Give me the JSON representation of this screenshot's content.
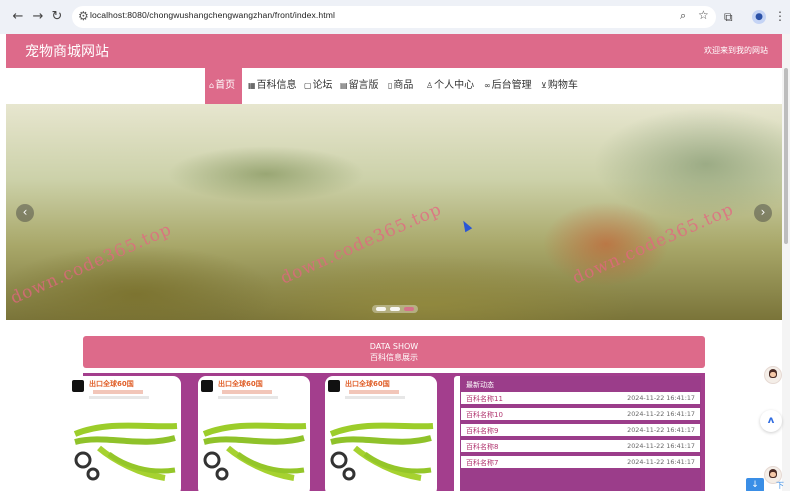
{
  "browser": {
    "url": "localhost:8080/chongwushangchengwangzhan/front/index.html",
    "back_icon": "arrow-left-icon",
    "forward_icon": "arrow-right-icon",
    "reload_icon": "reload-icon"
  },
  "header": {
    "site_title": "宠物商城网站",
    "welcome": "欢迎来到我的网站"
  },
  "nav": [
    {
      "label": "首页",
      "icon": "home-icon",
      "active": true
    },
    {
      "label": "百科信息",
      "icon": "grid-icon",
      "active": false
    },
    {
      "label": "论坛",
      "icon": "forum-icon",
      "active": false
    },
    {
      "label": "留言版",
      "icon": "message-icon",
      "active": false
    },
    {
      "label": "商品",
      "icon": "goods-icon",
      "active": false
    },
    {
      "label": "个人中心",
      "icon": "user-icon",
      "active": false
    },
    {
      "label": "后台管理",
      "icon": "link-icon",
      "active": false
    },
    {
      "label": "购物车",
      "icon": "cart-icon",
      "active": false
    }
  ],
  "banner": {
    "watermark": "down.code365.top",
    "active_slide": 1,
    "slide_count": 3
  },
  "section": {
    "title_en": "DATA SHOW",
    "title_cn": "百科信息展示"
  },
  "products": [
    {
      "tag": "出口全球60国"
    },
    {
      "tag": "出口全球60国"
    },
    {
      "tag": "出口全球60国"
    }
  ],
  "news": {
    "title": "最新动态",
    "items": [
      {
        "name": "百科名称11",
        "time": "2024-11-22 16:41:17"
      },
      {
        "name": "百科名称10",
        "time": "2024-11-22 16:41:17"
      },
      {
        "name": "百科名称9",
        "time": "2024-11-22 16:41:17"
      },
      {
        "name": "百科名称8",
        "time": "2024-11-22 16:41:17"
      },
      {
        "name": "百科名称7",
        "time": "2024-11-22 16:41:17"
      }
    ]
  },
  "floating": {
    "download_text": "下载"
  },
  "colors": {
    "primary": "#dd6a8a",
    "products_bg": "#a33e8d"
  }
}
